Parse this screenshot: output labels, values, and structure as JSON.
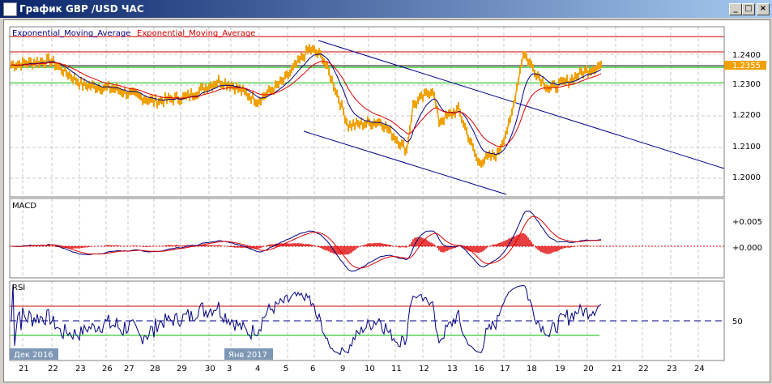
{
  "window": {
    "title": "График GBP /USD  ЧАС",
    "buttons": [
      "_",
      "□",
      "×"
    ]
  },
  "main": {
    "legend": [
      "Exponential_Moving_Average",
      "Exponential_Moving_Average"
    ],
    "price_ticks": [
      "1.2400",
      "1.2300",
      "1.2200",
      "1.2100",
      "1.2000"
    ],
    "current_price": "1.2355"
  },
  "macd": {
    "title": "MACD",
    "ticks": [
      "+0.005",
      "+0.000"
    ]
  },
  "rsi": {
    "title": "RSI",
    "ticks": [
      "50"
    ]
  },
  "x_axis": {
    "month_labels": [
      "Дек 2016",
      "Янв 2017"
    ],
    "dates": [
      "21",
      "22",
      "23",
      "26",
      "27",
      "28",
      "29",
      "30",
      "3",
      "4",
      "5",
      "6",
      "9",
      "10",
      "11",
      "12",
      "13",
      "16",
      "17",
      "18",
      "19",
      "20",
      "21",
      "22",
      "23",
      "24"
    ]
  },
  "colors": {
    "price": "#f0a000",
    "ema_fast": "#000080",
    "ema_slow": "#e00000",
    "green": "#00c000",
    "red": "#d00000"
  },
  "chart_data": {
    "type": "line",
    "price_axis": [
      1.195,
      1.2475
    ],
    "horizontal_levels": {
      "red": [
        1.2457,
        1.2408
      ],
      "black": [
        1.2363
      ],
      "green": [
        1.2358,
        1.2308
      ]
    },
    "keypoints_x": [
      0,
      6,
      11,
      16,
      22,
      27,
      32,
      34,
      38,
      42,
      46,
      48,
      50,
      52,
      57,
      61,
      62,
      65,
      66,
      69,
      72,
      75,
      77,
      79,
      81,
      83,
      86,
      88,
      91
    ],
    "keypoints_close": [
      1.2366,
      1.238,
      1.2301,
      1.2288,
      1.2248,
      1.2262,
      1.2314,
      1.2301,
      1.225,
      1.2314,
      1.2418,
      1.2392,
      1.2288,
      1.217,
      1.2183,
      1.2091,
      1.2235,
      1.2288,
      1.2183,
      1.2222,
      1.2052,
      1.2078,
      1.2183,
      1.2405,
      1.234,
      1.2288,
      1.2314,
      1.234,
      1.2366
    ],
    "rsi_levels": [
      70,
      50,
      30
    ]
  }
}
